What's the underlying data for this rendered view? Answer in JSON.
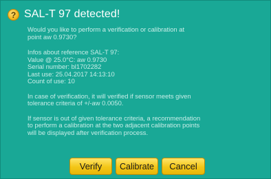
{
  "dialog": {
    "title": "SAL-T 97 detected!",
    "icon": "question-icon",
    "question": "Would you like to perform a verification or calibration at\npoint aw 0.9730?",
    "infos": "Infos about reference SAL-T 97:\nValue @ 25.0°C: aw 0.9730\nSerial number: bl1702282\nLast use: 25.04.2017 14:13:10\nCount of use: 10",
    "verification_note": "In case of verification, it will verified if sensor meets given\ntolerance criteria of +/-aw 0.0050.",
    "tolerance_note": "If sensor is out of given tolerance criteria, a recommendation\nto perform a calibration at the two adjacent calibration points\nwill be displayed after verification process."
  },
  "buttons": {
    "verify": "Verify",
    "calibrate": "Calibrate",
    "cancel": "Cancel"
  },
  "colors": {
    "dialog_background": "#19a896",
    "title_text": "#ffffff",
    "body_text": "#c7eee8",
    "button_fill": "#f3c617",
    "icon_fill": "#f2b81f"
  }
}
